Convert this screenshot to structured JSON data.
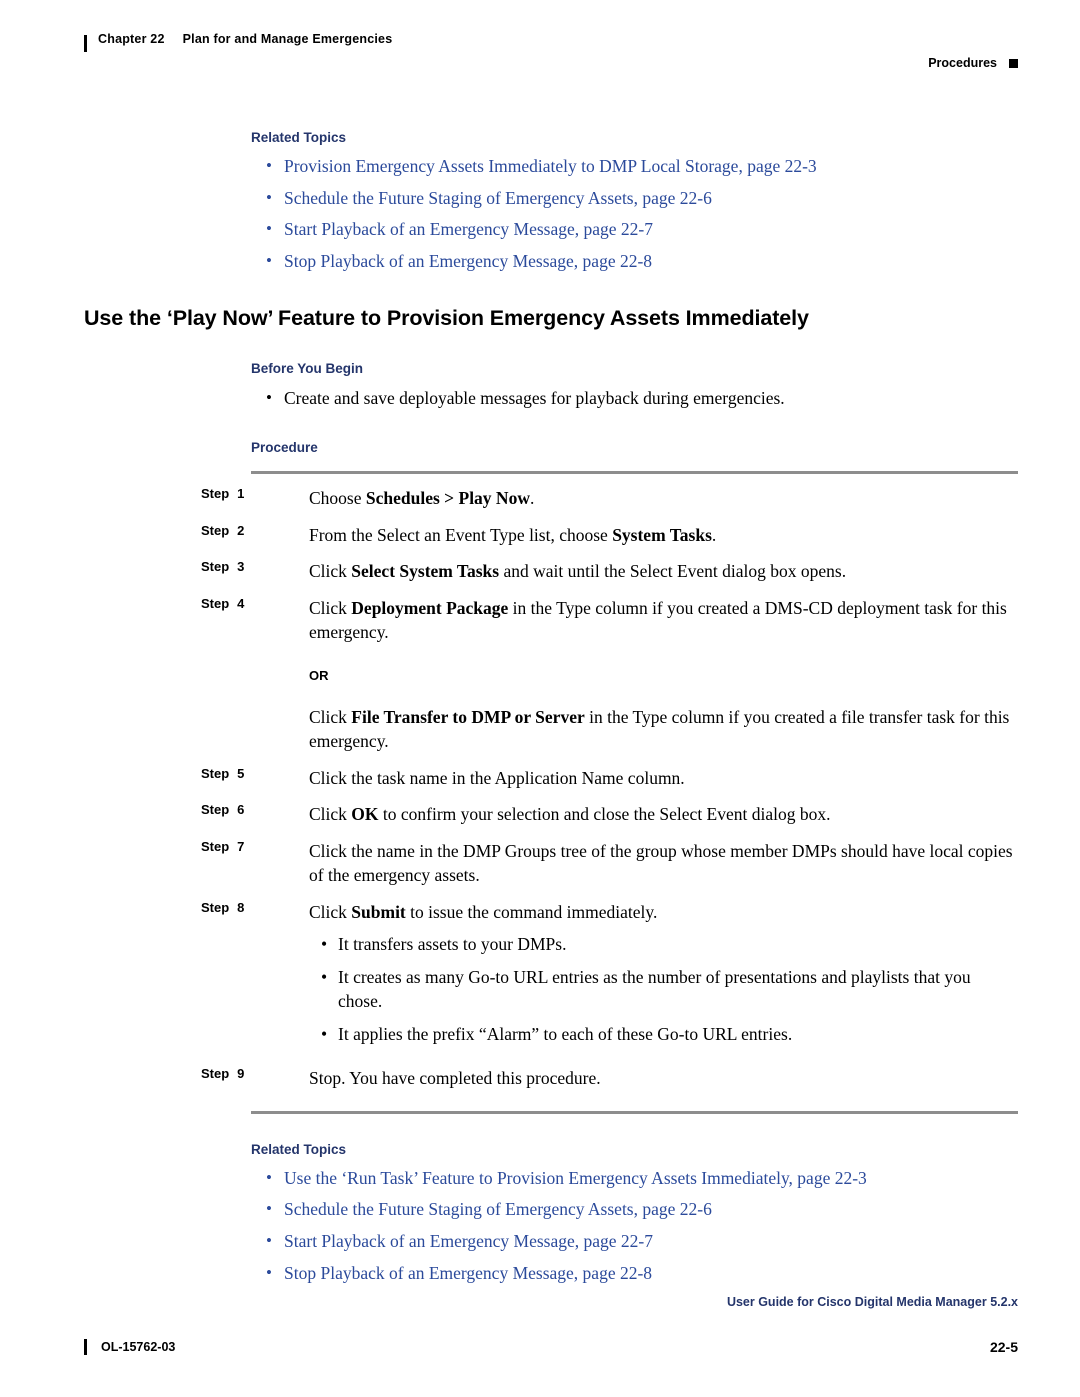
{
  "header": {
    "chapter_label": "Chapter 22",
    "chapter_title": "Plan for and Manage Emergencies",
    "section_marker": "Procedures"
  },
  "top_related": {
    "heading": "Related Topics",
    "links": [
      "Provision Emergency Assets Immediately to DMP Local Storage, page 22-3",
      "Schedule the Future Staging of Emergency Assets, page 22-6",
      "Start Playback of an Emergency Message, page 22-7",
      "Stop Playback of an Emergency Message, page 22-8"
    ]
  },
  "section": {
    "title": "Use the ‘Play Now’ Feature to Provision Emergency Assets Immediately",
    "before_you_begin_heading": "Before You Begin",
    "before_you_begin_items": [
      "Create and save deployable messages for playback during emergencies."
    ],
    "procedure_heading": "Procedure"
  },
  "steps": [
    {
      "label": "Step",
      "number": "1",
      "text_parts": [
        {
          "t": "Choose ",
          "b": false
        },
        {
          "t": "Schedules > Play Now",
          "b": true
        },
        {
          "t": ".",
          "b": false
        }
      ]
    },
    {
      "label": "Step",
      "number": "2",
      "text_parts": [
        {
          "t": "From the Select an Event Type list, choose ",
          "b": false
        },
        {
          "t": "System Tasks",
          "b": true
        },
        {
          "t": ".",
          "b": false
        }
      ]
    },
    {
      "label": "Step",
      "number": "3",
      "text_parts": [
        {
          "t": "Click ",
          "b": false
        },
        {
          "t": "Select System Tasks",
          "b": true
        },
        {
          "t": " and wait until the Select Event dialog box opens.",
          "b": false
        }
      ]
    },
    {
      "label": "Step",
      "number": "4",
      "text_parts": [
        {
          "t": "Click ",
          "b": false
        },
        {
          "t": "Deployment Package",
          "b": true
        },
        {
          "t": " in the Type column if you created a DMS-CD deployment task for this emergency.",
          "b": false
        }
      ],
      "or_label": "OR",
      "alt_parts": [
        {
          "t": "Click ",
          "b": false
        },
        {
          "t": "File Transfer to DMP or Server",
          "b": true
        },
        {
          "t": " in the Type column if you created a file transfer task for this emergency.",
          "b": false
        }
      ]
    },
    {
      "label": "Step",
      "number": "5",
      "text_parts": [
        {
          "t": "Click the task name in the Application Name column.",
          "b": false
        }
      ]
    },
    {
      "label": "Step",
      "number": "6",
      "text_parts": [
        {
          "t": "Click ",
          "b": false
        },
        {
          "t": "OK",
          "b": true
        },
        {
          "t": " to confirm your selection and close the Select Event dialog box.",
          "b": false
        }
      ]
    },
    {
      "label": "Step",
      "number": "7",
      "text_parts": [
        {
          "t": "Click the name in the DMP Groups tree of the group whose member DMPs should have local copies of the emergency assets.",
          "b": false
        }
      ]
    },
    {
      "label": "Step",
      "number": "8",
      "text_parts": [
        {
          "t": "Click ",
          "b": false
        },
        {
          "t": "Submit",
          "b": true
        },
        {
          "t": " to issue the command immediately.",
          "b": false
        }
      ],
      "substeps": [
        "It transfers assets to your DMPs.",
        "It creates as many Go-to URL entries as the number of presentations and playlists that you chose.",
        "It applies the prefix “Alarm” to each of these Go-to URL entries."
      ]
    },
    {
      "label": "Step",
      "number": "9",
      "text_parts": [
        {
          "t": "Stop. You have completed this procedure.",
          "b": false
        }
      ]
    }
  ],
  "bottom_related": {
    "heading": "Related Topics",
    "links": [
      "Use the ‘Run Task’ Feature to Provision Emergency Assets Immediately, page 22-3",
      "Schedule the Future Staging of Emergency Assets, page 22-6",
      "Start Playback of an Emergency Message, page 22-7",
      "Stop Playback of an Emergency Message, page 22-8"
    ]
  },
  "footer": {
    "guide_title": "User Guide for Cisco Digital Media Manager 5.2.x",
    "doc_number": "OL-15762-03",
    "page_number": "22-5"
  }
}
